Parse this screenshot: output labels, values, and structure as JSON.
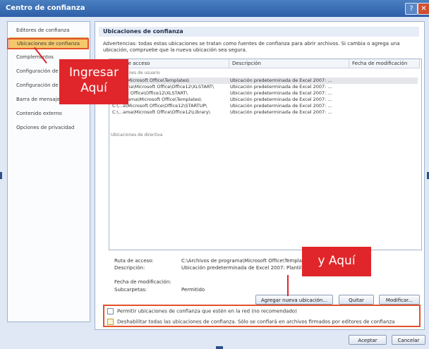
{
  "window": {
    "title": "Centro de confianza",
    "help": "?",
    "close": "✕"
  },
  "sidebar": {
    "items": [
      {
        "label": "Editores de confianza",
        "selected": false
      },
      {
        "label": "Ubicaciones de confianza",
        "selected": true
      },
      {
        "label": "Complementos",
        "selected": false
      },
      {
        "label": "Configuración de ActiveX",
        "selected": false
      },
      {
        "label": "Configuración de macros",
        "selected": false
      },
      {
        "label": "Barra de mensajes",
        "selected": false
      },
      {
        "label": "Contenido externo",
        "selected": false
      },
      {
        "label": "Opciones de privacidad",
        "selected": false
      }
    ]
  },
  "main": {
    "section_title": "Ubicaciones de confianza",
    "warning_line1": "Advertencias: todas estas ubicaciones se tratan como fuentes de confianza para abrir archivos. Si cambia o agrega una",
    "warning_line2": "ubicación, compruebe que la nueva ubicación sea segura.",
    "columns": {
      "path": "Ruta de acceso",
      "description": "Descripción",
      "modified": "Fecha de modificación"
    },
    "group_user": "Ubicaciones de usuario",
    "rows": [
      {
        "path": "C:\\...a\\Microsoft Office\\Templates\\",
        "description": "Ubicación predeterminada de Excel 2007: ...",
        "selected": true
      },
      {
        "path": "C:\\...ama\\Microsoft Office\\Office12\\XLSTART\\",
        "description": "Ubicación predeterminada de Excel 2007: ...",
        "selected": false
      },
      {
        "path": "C:\\...oft Office\\Office12\\XLSTART\\",
        "description": "Ubicación predeterminada de Excel 2007: ...",
        "selected": false
      },
      {
        "path": "C:\\...grama\\Microsoft Office\\Templates\\",
        "description": "Ubicación predeterminada de Excel 2007: ...",
        "selected": false
      },
      {
        "path": "C:\\...a\\Microsoft Office\\Office12\\STARTUP\\",
        "description": "Ubicación predeterminada de Excel 2007: ...",
        "selected": false
      },
      {
        "path": "C:\\...ama\\Microsoft Office\\Office12\\Library\\",
        "description": "Ubicación predeterminada de Excel 2007: ...",
        "selected": false
      }
    ],
    "group_policy": "Ubicaciones de directiva",
    "details": {
      "path_label": "Ruta de acceso:",
      "path_value": "C:\\Archivos de programa\\Microsoft Office\\Templates\\",
      "desc_label": "Descripción:",
      "desc_value": "Ubicación predeterminada de Excel 2007: Plantillas",
      "date_label": "Fecha de modificación:",
      "sub_label": "Subcarpetas:",
      "sub_value": "Permitido"
    },
    "buttons": {
      "add": "Agregar nueva ubicación...",
      "remove": "Quitar",
      "modify": "Modificar..."
    },
    "checkbox1": "Permitir ubicaciones de confianza que estén en la red (no recomendado)",
    "checkbox2": "Deshabilitar todas las ubicaciones de confianza. Sólo se confiará en archivos firmados por editores de confianza"
  },
  "footer": {
    "ok": "Aceptar",
    "cancel": "Cancelar"
  },
  "annotations": {
    "callout1_line1": "Ingresar",
    "callout1_line2": "Aquí",
    "callout2": "y Aquí",
    "color": "#e0262a"
  }
}
